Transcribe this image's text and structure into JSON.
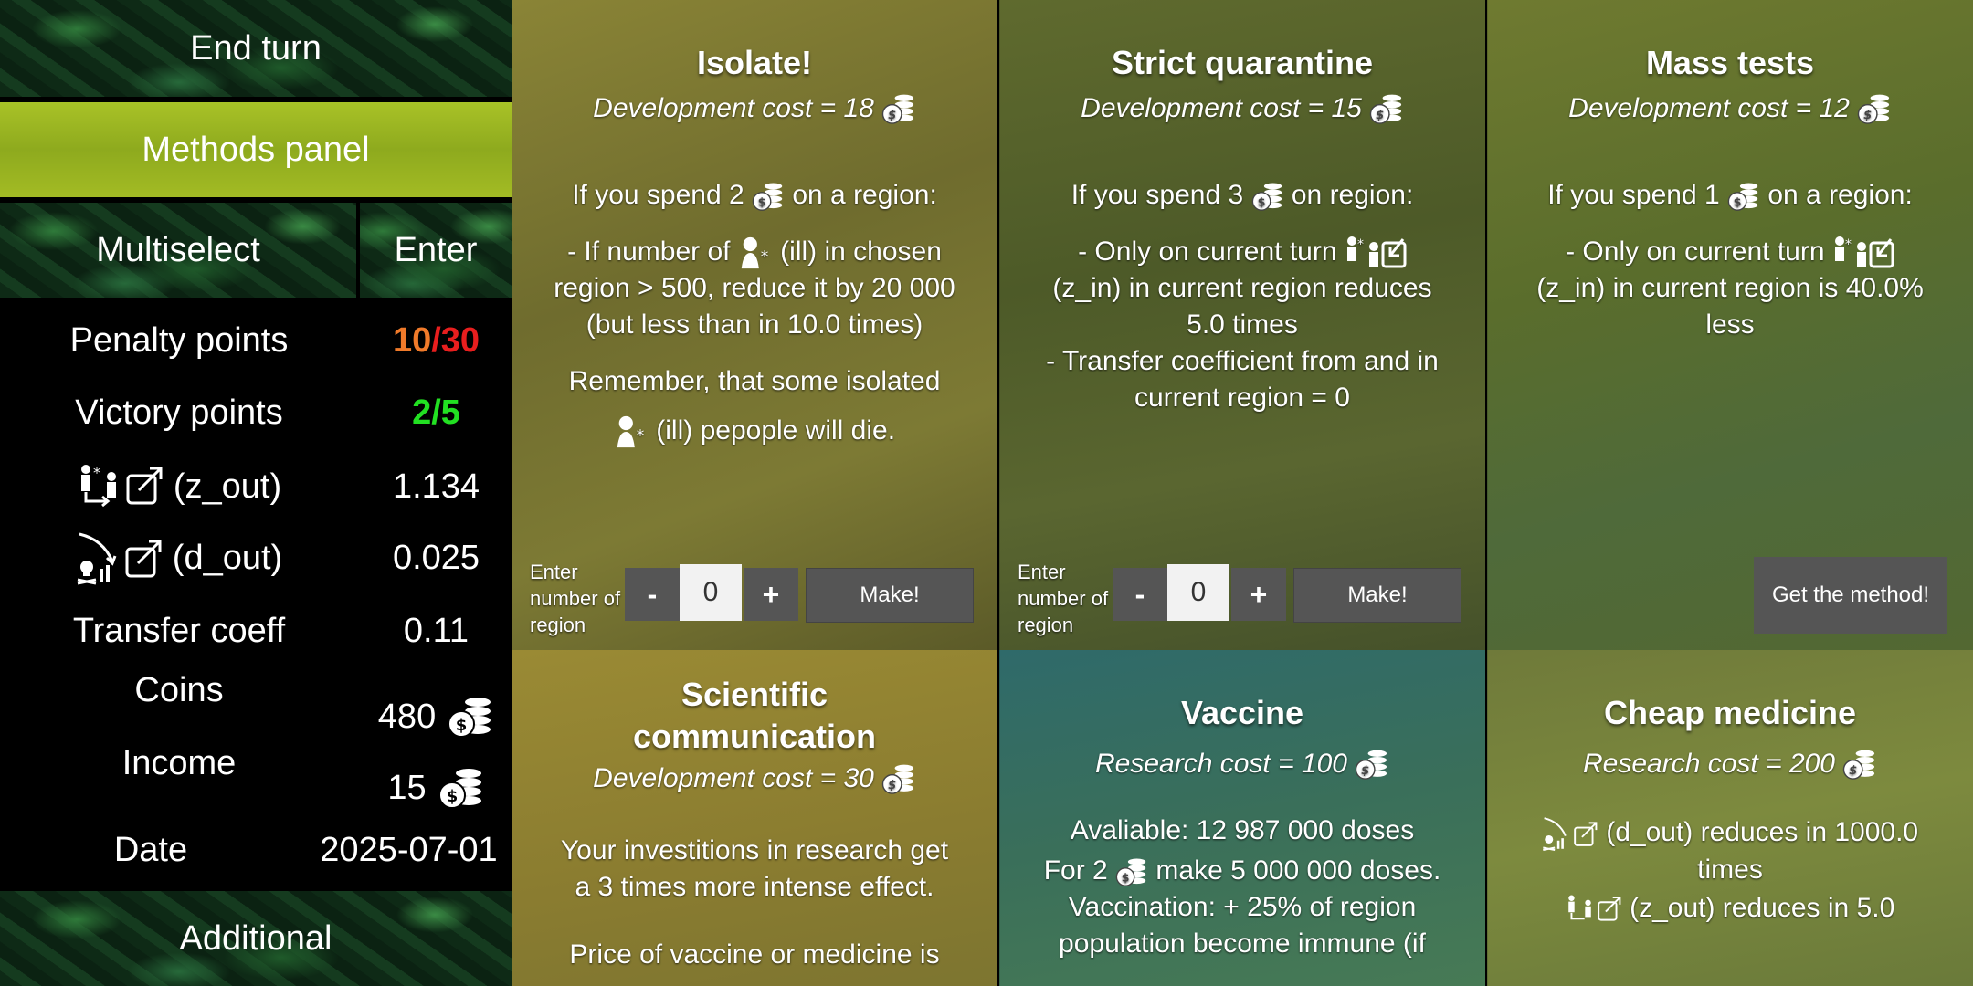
{
  "sidebar": {
    "end_turn": "End turn",
    "methods_panel": "Methods panel",
    "multiselect": "Multiselect",
    "enter": "Enter",
    "additional": "Additional",
    "stats": {
      "penalty_label": "Penalty points",
      "penalty_current": "10",
      "penalty_sep": "/",
      "penalty_max": "30",
      "victory_label": "Victory points",
      "victory_value": "2/5",
      "z_out_label": "(z_out)",
      "z_out_value": "1.134",
      "d_out_label": "(d_out)",
      "d_out_value": "0.025",
      "transfer_label": "Transfer coeff",
      "transfer_value": "0.11",
      "coins_label": "Coins",
      "coins_value": "480",
      "income_label": "Income",
      "income_value": "15",
      "date_label": "Date",
      "date_value": "2025-07-01"
    }
  },
  "cards": {
    "isolate": {
      "title": "Isolate!",
      "cost": "Development cost = 18",
      "line1a": "If you spend 2",
      "line1b": "on a region:",
      "line2a": "- If number of",
      "line2b": "(ill) in chosen",
      "line3": "region > 500, reduce it by 20 000",
      "line4": "(but less than in 10.0 times)",
      "line5": "Remember, that some isolated",
      "line6": "(ill) pepople will die.",
      "region_label": "Enter number of region",
      "value": "0",
      "minus": "-",
      "plus": "+",
      "make": "Make!"
    },
    "strict": {
      "title": "Strict quarantine",
      "cost": "Development cost = 15",
      "line1a": "If you spend 3",
      "line1b": "on region:",
      "line2": "- Only on current turn",
      "line3": "(z_in) in current region reduces",
      "line4": "5.0 times",
      "line5": "- Transfer coefficient from and in",
      "line6": "current region = 0",
      "region_label": "Enter number of region",
      "value": "0",
      "minus": "-",
      "plus": "+",
      "make": "Make!"
    },
    "mass": {
      "title": "Mass tests",
      "cost": "Development cost = 12",
      "line1a": "If you spend 1",
      "line1b": "on a region:",
      "line2": "- Only on current turn",
      "line3": "(z_in) in current region is 40.0%",
      "line4": "less",
      "get": "Get the method!"
    },
    "sci": {
      "title": "Scientific communication",
      "cost": "Development cost = 30",
      "line1": "Your investitions in research get",
      "line2": "a 3 times more intense effect.",
      "line3": "Price of vaccine or medicine is"
    },
    "vaccine": {
      "title": "Vaccine",
      "cost": "Research cost = 100",
      "line1": "Avaliable: 12 987 000 doses",
      "line2a": "For 2",
      "line2b": "make 5 000 000 doses.",
      "line3": "Vaccination: + 25% of region",
      "line4": "population become immune (if"
    },
    "cheap": {
      "title": "Cheap medicine",
      "cost": "Research cost = 200",
      "line1": "(d_out) reduces in 1000.0",
      "line2": "times",
      "line3": "(z_out) reduces in 5.0"
    }
  }
}
